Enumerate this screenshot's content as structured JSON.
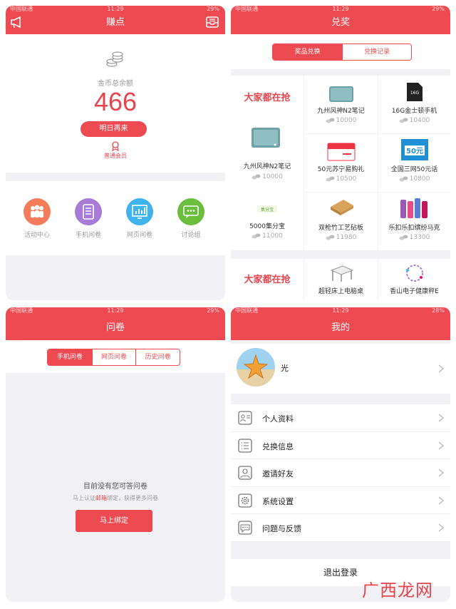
{
  "status_bar": {
    "carrier": "中国联通",
    "time": "11:29",
    "battery_3": "29%",
    "battery_4": "28%"
  },
  "s1": {
    "title": "赚点",
    "balance_label": "金币总余额",
    "balance": "466",
    "btn": "明日再来",
    "member": "普通会员",
    "entries": [
      {
        "label": "活动中心",
        "color": "#f47c5a"
      },
      {
        "label": "手机问卷",
        "color": "#a77bd8"
      },
      {
        "label": "网页问卷",
        "color": "#3eb3ee"
      },
      {
        "label": "讨论组",
        "color": "#6bbd3c"
      }
    ]
  },
  "s2": {
    "title": "兑奖",
    "tabs": [
      "奖品兑换",
      "兑换记录"
    ],
    "hot": "大家都在抢",
    "items": [
      {
        "name": "九州风神N2笔记",
        "points": "10000"
      },
      {
        "name": "16G金士顿手机",
        "points": "10400"
      },
      {
        "name": "九州风神N2笔记",
        "points": "10000"
      },
      {
        "name": "50元苏宁易购礼",
        "points": "10500"
      },
      {
        "name": "全国三网50元话",
        "points": "10800"
      },
      {
        "name": "5000集分宝",
        "points": "11000"
      },
      {
        "name": "双枪竹工艺砧板",
        "points": "11980"
      },
      {
        "name": "乐扣乐扣缤纷马克",
        "points": "13300"
      },
      {
        "name": "超轻床上电脑桌",
        "points": ""
      },
      {
        "name": "香山电子健康秤E",
        "points": ""
      }
    ],
    "sd_label": "16G",
    "card_label": "50元",
    "brand_label": "集分宝"
  },
  "s3": {
    "title": "问卷",
    "tabs": [
      "手机问卷",
      "网页问卷",
      "历史问卷"
    ],
    "empty": "目前没有您可答问卷",
    "hint_a": "马上认证",
    "hint_link": "邮箱",
    "hint_b": "绑定，获得更多问卷",
    "btn": "马上绑定"
  },
  "s4": {
    "title": "我的",
    "user": "光",
    "menu": [
      "个人资料",
      "兑换信息",
      "邀请好友",
      "系统设置",
      "问题与反馈"
    ],
    "logout": "退出登录"
  },
  "watermark": "广西龙网"
}
